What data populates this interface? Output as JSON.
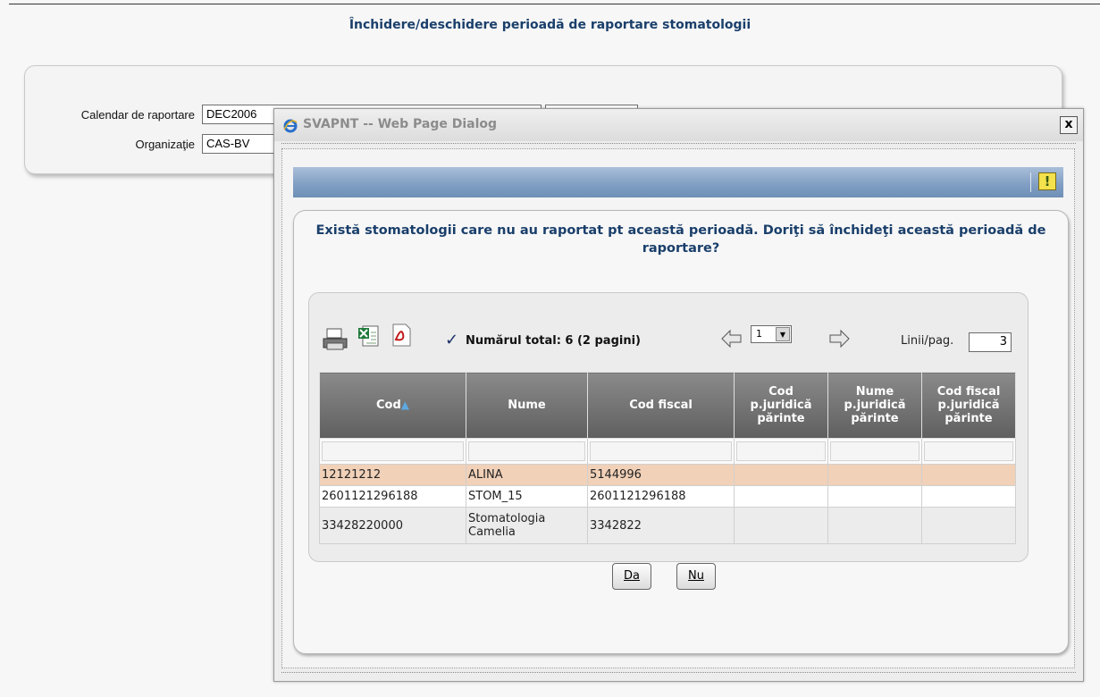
{
  "page": {
    "title": "Închidere/deschidere perioadă de raportare stomatologii"
  },
  "filters": {
    "calendar_label": "Calendar de raportare",
    "calendar_value": "DEC2006",
    "org_label": "Organizaţie",
    "org_value": "CAS-BV"
  },
  "dialog": {
    "title": "SVAPNT -- Web Page Dialog",
    "close_label": "x",
    "question": "Există stomatologii care nu au raportat pt această perioadă. Doriţi să închideţi această perioadă de raportare?",
    "warning_icon_label": "!"
  },
  "grid": {
    "total_text": "Numărul total: 6 (2 pagini)",
    "page_value": "1",
    "rows_label": "Linii/pag.",
    "rows_value": "3",
    "columns": {
      "c1": "Cod",
      "c2": "Nume",
      "c3": "Cod fiscal",
      "c4": "Cod p.juridică părinte",
      "c5": "Nume p.juridică părinte",
      "c6": "Cod fiscal p.juridică părinte"
    },
    "rows": [
      {
        "cod": "12121212",
        "nume": "ALINA",
        "cod_fiscal": "5144996"
      },
      {
        "cod": "2601121296188",
        "nume": "STOM_15",
        "cod_fiscal": "2601121296188"
      },
      {
        "cod": "33428220000",
        "nume": "Stomatologia Camelia",
        "cod_fiscal": "3342822"
      }
    ]
  },
  "buttons": {
    "yes_label": "Da",
    "no_label": "Nu"
  },
  "icons": {
    "print": "print-icon",
    "excel": "excel-icon",
    "pdf": "pdf-icon",
    "check": "check-icon",
    "prev": "arrow-left-icon",
    "next": "arrow-right-icon",
    "ie": "ie-logo-icon",
    "warning": "warning-icon"
  },
  "colors": {
    "title_blue": "#1a3f6b",
    "header_gray": "#6f6f6f",
    "selected_row": "#f1d1b8",
    "bar_blue": "#7f9dc2"
  }
}
